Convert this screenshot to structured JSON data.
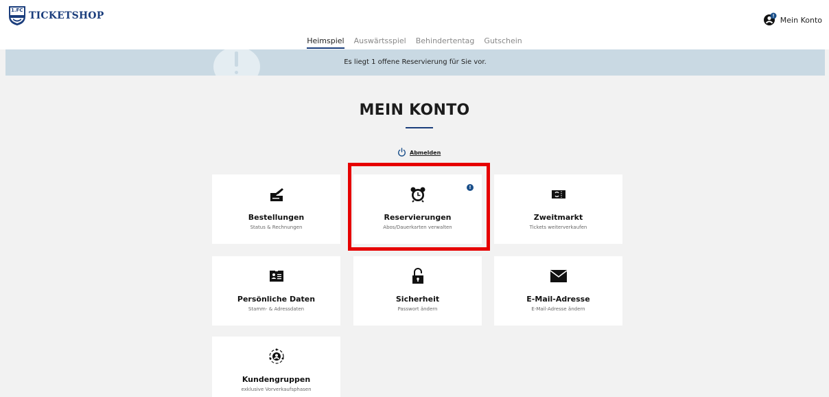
{
  "header": {
    "brand": "TICKETSHOP",
    "logo_text": "1.FC",
    "account_label": "Mein Konto"
  },
  "nav": {
    "tabs": [
      {
        "label": "Heimspiel",
        "active": true
      },
      {
        "label": "Auswärtsspiel",
        "active": false
      },
      {
        "label": "Behindertentag",
        "active": false
      },
      {
        "label": "Gutschein",
        "active": false
      }
    ]
  },
  "notice": {
    "text": "Es liegt 1 offene Reservierung für Sie vor."
  },
  "main": {
    "title": "MEIN KONTO",
    "logout_label": "Abmelden"
  },
  "cards": [
    {
      "title": "Bestellungen",
      "subtitle": "Status & Rechnungen",
      "icon": "order-icon"
    },
    {
      "title": "Reservierungen",
      "subtitle": "Abos/Dauerkarten verwalten",
      "icon": "alarm-clock-icon",
      "badge": "!"
    },
    {
      "title": "Zweitmarkt",
      "subtitle": "Tickets weiterverkaufen",
      "icon": "ticket-exchange-icon"
    },
    {
      "title": "Persönliche Daten",
      "subtitle": "Stamm- & Adressdaten",
      "icon": "id-card-icon"
    },
    {
      "title": "Sicherheit",
      "subtitle": "Passwort ändern",
      "icon": "lock-icon"
    },
    {
      "title": "E-Mail-Adresse",
      "subtitle": "E-Mail-Adresse ändern",
      "icon": "envelope-icon"
    },
    {
      "title": "Kundengruppen",
      "subtitle": "exklusive Vorverkaufsphasen",
      "icon": "customer-group-icon"
    }
  ],
  "colors": {
    "brand_blue": "#1a3d7c",
    "notice_bg": "#c9d9e3",
    "highlight_red": "#e60000",
    "badge_blue": "#1a4f8a"
  }
}
